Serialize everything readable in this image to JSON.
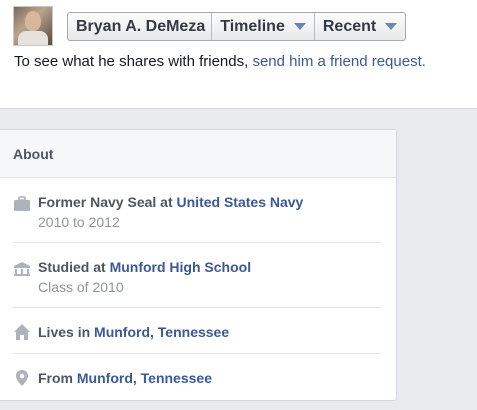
{
  "header": {
    "name_button": "Bryan A. DeMeza",
    "timeline_button": "Timeline",
    "recent_button": "Recent",
    "friend_prompt": "To see what he shares with friends,",
    "friend_link": "send him a friend request."
  },
  "about": {
    "title": "About",
    "items": [
      {
        "icon": "briefcase-icon",
        "prefix": "Former Navy Seal at ",
        "link": "United States Navy",
        "sub": "2010 to 2012"
      },
      {
        "icon": "school-icon",
        "prefix": "Studied at ",
        "link": "Munford High School",
        "sub": "Class of 2010"
      },
      {
        "icon": "home-icon",
        "prefix": "Lives in ",
        "link": "Munford, Tennessee",
        "sub": ""
      },
      {
        "icon": "location-pin-icon",
        "prefix": "From ",
        "link": "Munford, Tennessee",
        "sub": ""
      }
    ]
  },
  "colors": {
    "link": "#3b5998",
    "caret": "#6d84b4",
    "icon": "#adb2bb",
    "background": "#e9eaed"
  }
}
